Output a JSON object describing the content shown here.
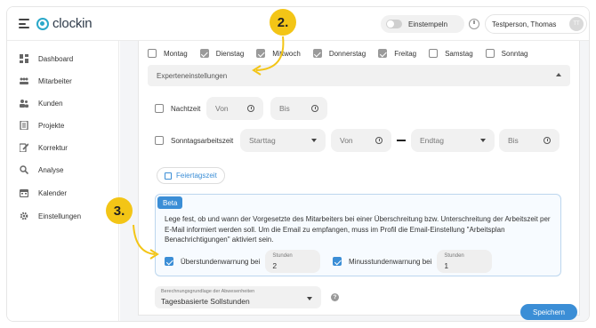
{
  "app": {
    "name": "clockin",
    "brand_color": "#2aa8c9",
    "accent_color": "#3b8ed6",
    "annotation_color": "#f3c516"
  },
  "topbar": {
    "stamp_label": "Einstempeln",
    "user_name": "Testperson, Thomas",
    "user_initials": "TT"
  },
  "sidebar": {
    "items": [
      {
        "label": "Dashboard",
        "icon": "dashboard-icon"
      },
      {
        "label": "Mitarbeiter",
        "icon": "employees-icon"
      },
      {
        "label": "Kunden",
        "icon": "customers-icon"
      },
      {
        "label": "Projekte",
        "icon": "projects-icon"
      },
      {
        "label": "Korrektur",
        "icon": "correction-icon"
      },
      {
        "label": "Analyse",
        "icon": "analysis-icon"
      },
      {
        "label": "Kalender",
        "icon": "calendar-icon"
      },
      {
        "label": "Einstellungen",
        "icon": "settings-icon"
      }
    ]
  },
  "days": [
    {
      "label": "Montag",
      "state": "unchecked"
    },
    {
      "label": "Dienstag",
      "state": "checked"
    },
    {
      "label": "Mittwoch",
      "state": "checked"
    },
    {
      "label": "Donnerstag",
      "state": "checked"
    },
    {
      "label": "Freitag",
      "state": "checked"
    },
    {
      "label": "Samstag",
      "state": "unchecked"
    },
    {
      "label": "Sonntag",
      "state": "unchecked"
    }
  ],
  "expert": {
    "label": "Experteneinstellungen"
  },
  "night": {
    "label": "Nachtzeit",
    "from_placeholder": "Von",
    "to_placeholder": "Bis"
  },
  "sunday": {
    "label": "Sonntagsarbeitszeit",
    "start_day": "Starttag",
    "from_placeholder": "Von",
    "end_day": "Endtag",
    "to_placeholder": "Bis"
  },
  "holiday": {
    "label": "Feiertagszeit"
  },
  "beta": {
    "badge": "Beta",
    "text": "Lege fest, ob und wann der Vorgesetzte des Mitarbeiters bei einer Überschreitung bzw. Unterschreitung der Arbeitszeit per E-Mail informiert werden soll. Um die Email zu empfangen, muss im Profil die Email-Einstellung \"Arbeitsplan Benachrichtigungen\" aktiviert sein.",
    "over": {
      "label": "Überstundenwarnung bei",
      "hours_label": "Stunden",
      "hours_value": "2"
    },
    "under": {
      "label": "Minusstundenwarnung bei",
      "hours_label": "Stunden",
      "hours_value": "1"
    }
  },
  "basis": {
    "label": "Berechnungsgrundlage der Abwesenheiten",
    "value": "Tagesbasierte Sollstunden",
    "help": "?"
  },
  "save_label": "Speichern",
  "steps": {
    "two": "2.",
    "three": "3."
  }
}
